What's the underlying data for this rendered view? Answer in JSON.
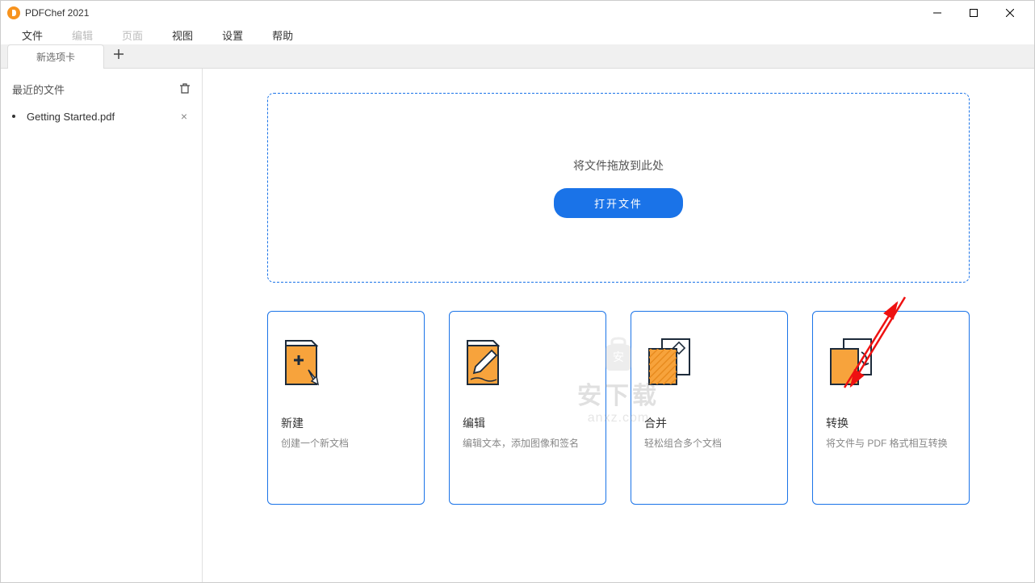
{
  "app": {
    "title": "PDFChef 2021"
  },
  "menu": {
    "items": [
      {
        "label": "文件",
        "disabled": false
      },
      {
        "label": "编辑",
        "disabled": true
      },
      {
        "label": "页面",
        "disabled": true
      },
      {
        "label": "视图",
        "disabled": false
      },
      {
        "label": "设置",
        "disabled": false
      },
      {
        "label": "帮助",
        "disabled": false
      }
    ]
  },
  "tabs": {
    "active_label": "新选项卡"
  },
  "sidebar": {
    "recent_header": "最近的文件",
    "files": [
      {
        "name": "Getting Started.pdf"
      }
    ]
  },
  "dropzone": {
    "text": "将文件拖放到此处",
    "button": "打开文件"
  },
  "watermark": {
    "text": "安下载",
    "sub": "anxz.com"
  },
  "cards": [
    {
      "title": "新建",
      "desc": "创建一个新文档"
    },
    {
      "title": "编辑",
      "desc": "编辑文本，添加图像和签名"
    },
    {
      "title": "合并",
      "desc": "轻松组合多个文档"
    },
    {
      "title": "转换",
      "desc": "将文件与 PDF 格式相互转换"
    }
  ]
}
